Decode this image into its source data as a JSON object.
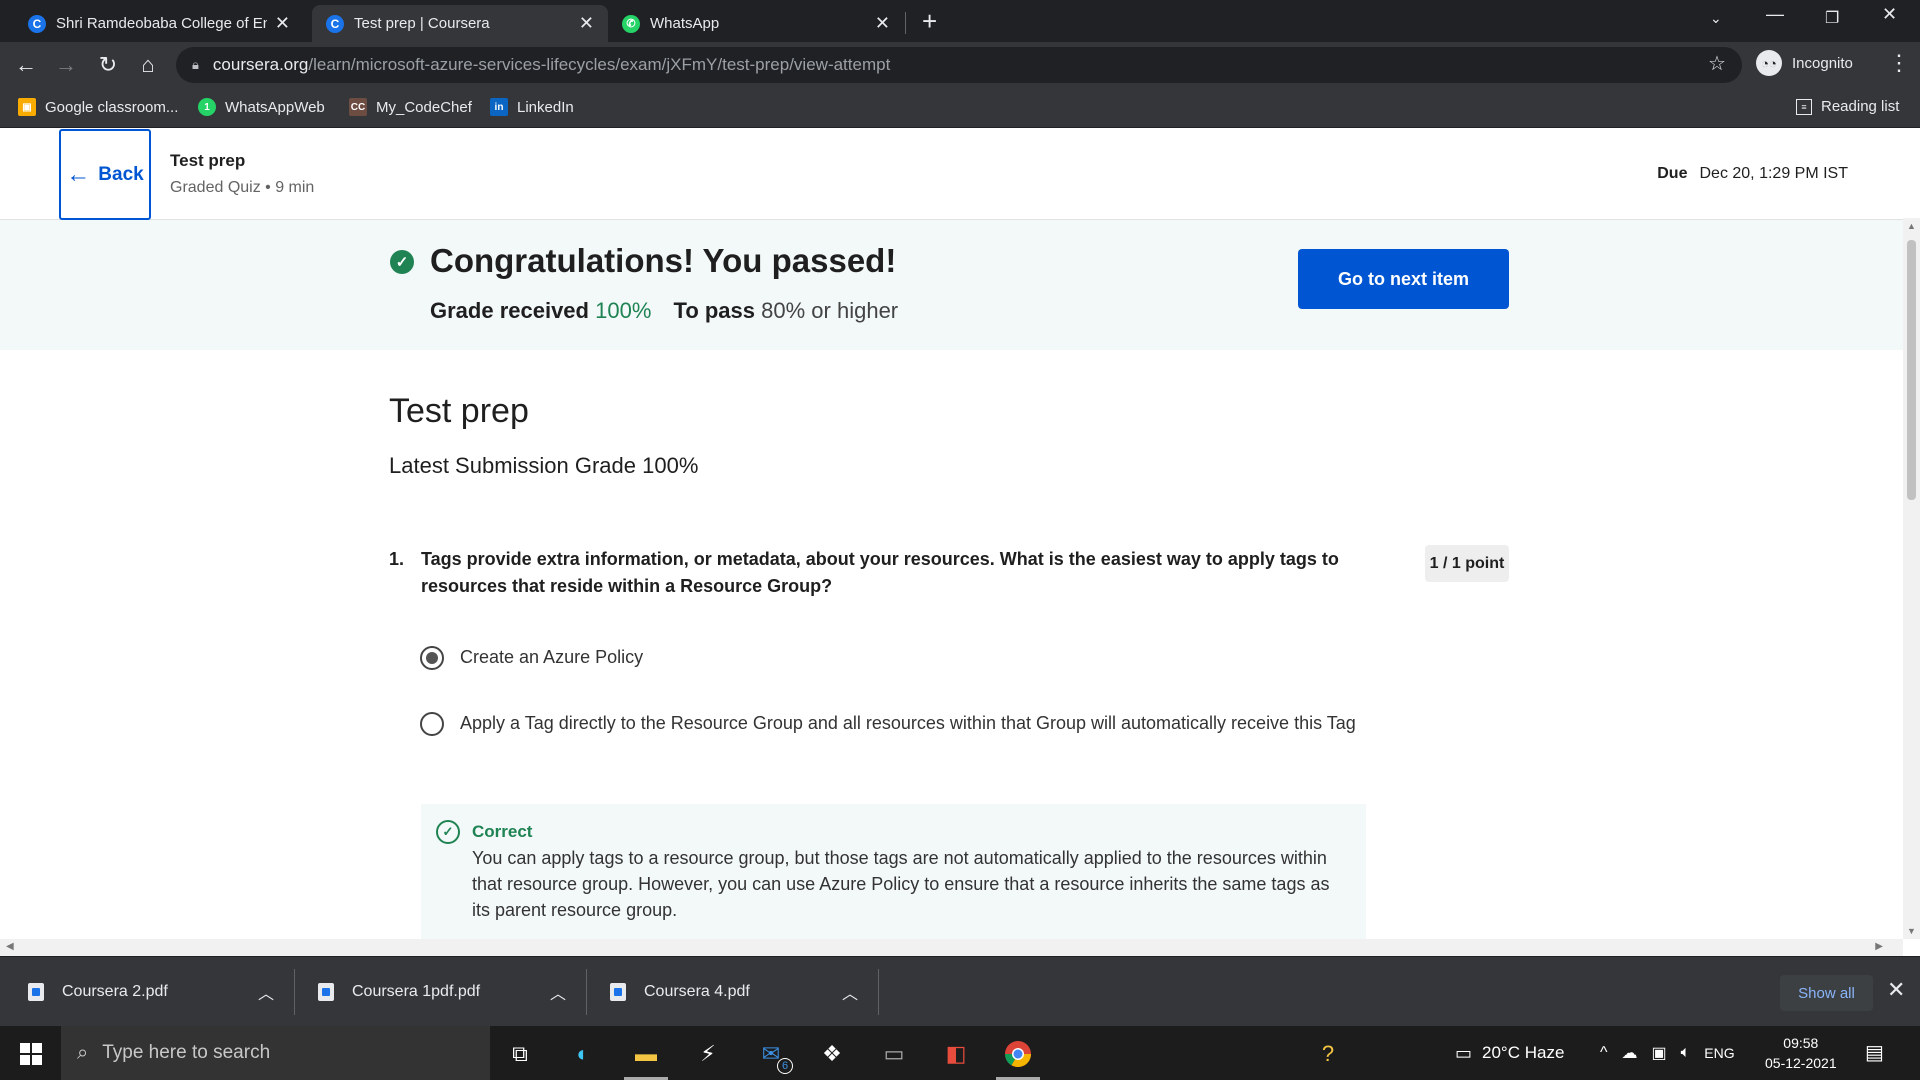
{
  "browser": {
    "tabs": [
      {
        "title": "Shri Ramdeobaba College of Eng",
        "icon": "coursera-favicon",
        "active": false
      },
      {
        "title": "Test prep | Coursera",
        "icon": "coursera-favicon",
        "active": true
      },
      {
        "title": "WhatsApp",
        "icon": "whatsapp-favicon",
        "active": false
      }
    ],
    "tab_close": "✕",
    "new_tab": "+",
    "url_host": "coursera.org",
    "url_path": "/learn/microsoft-azure-services-lifecycles/exam/jXFmY/test-prep/view-attempt",
    "incognito_label": "Incognito",
    "bookmarks": [
      {
        "label": "Google classroom...",
        "icon": "google-classroom-icon"
      },
      {
        "label": "WhatsAppWeb",
        "icon": "whatsapp-icon"
      },
      {
        "label": "My_CodeChef",
        "icon": "codechef-icon"
      },
      {
        "label": "LinkedIn",
        "icon": "linkedin-icon"
      }
    ],
    "reading_list": "Reading list"
  },
  "header": {
    "back_label": "Back",
    "title": "Test prep",
    "subtitle": "Graded Quiz • 9 min",
    "due_label": "Due",
    "due_value": "Dec 20, 1:29 PM IST"
  },
  "banner": {
    "congrats": "Congratulations! You passed!",
    "grade_label": "Grade received",
    "grade_value": "100%",
    "pass_label": "To pass",
    "pass_value": "80% or higher",
    "next_button": "Go to next item",
    "colors": {
      "success": "#1f8354",
      "primary": "#0056d2"
    }
  },
  "main": {
    "title": "Test prep",
    "latest_grade": "Latest Submission Grade 100%",
    "question": {
      "number": "1.",
      "text": "Tags provide extra information, or metadata, about your resources. What is the easiest way to apply tags to resources that reside within a Resource Group?",
      "points": "1 / 1 point",
      "options": [
        {
          "text": "Create an Azure Policy",
          "selected": true
        },
        {
          "text": "Apply a Tag directly to the Resource Group and all resources within that Group will automatically receive this Tag",
          "selected": false
        }
      ],
      "feedback_title": "Correct",
      "feedback_text": "You can apply tags to a resource group, but those tags are not automatically applied to the resources within that resource group. However, you can use Azure Policy to ensure that a resource inherits the same tags as its parent resource group."
    }
  },
  "downloads": {
    "items": [
      "Coursera 2.pdf",
      "Coursera 1pdf.pdf",
      "Coursera 4.pdf"
    ],
    "show_all": "Show all"
  },
  "taskbar": {
    "search_placeholder": "Type here to search",
    "mail_badge": "6",
    "weather": "20°C  Haze",
    "language": "ENG",
    "time": "09:58",
    "date": "05-12-2021"
  }
}
